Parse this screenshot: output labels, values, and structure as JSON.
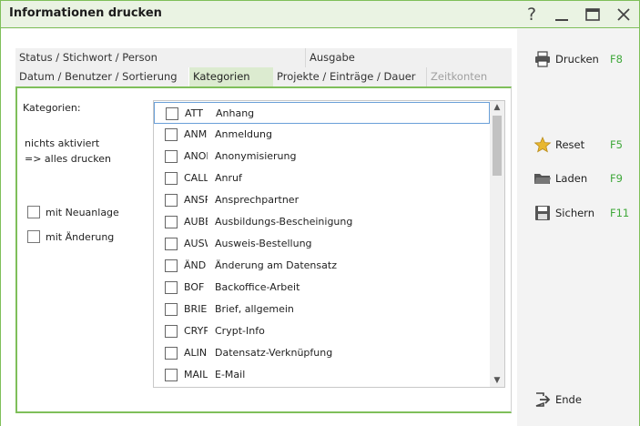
{
  "window": {
    "title": "Informationen drucken"
  },
  "titlebar": {
    "help_label": "?"
  },
  "tabs_row1": [
    {
      "label": "Status / Stichwort / Person"
    },
    {
      "label": "Ausgabe"
    }
  ],
  "tabs_row2": [
    {
      "label": "Datum / Benutzer / Sortierung"
    },
    {
      "label": "Kategorien"
    },
    {
      "label": "Projekte / Einträge / Dauer"
    },
    {
      "label": "Zeitkonten"
    }
  ],
  "panel": {
    "kategorien_label": "Kategorien:",
    "hint_line1": "nichts aktiviert",
    "hint_line2": "=> alles drucken",
    "neuanlage_label": "mit Neuanlage",
    "aenderung_label": "mit Änderung",
    "neuanlage_checked": false,
    "aenderung_checked": false
  },
  "categories": [
    {
      "code": "ATT",
      "name": "Anhang",
      "checked": false
    },
    {
      "code": "ANM",
      "name": "Anmeldung",
      "checked": false
    },
    {
      "code": "ANON",
      "name": "Anonymisierung",
      "checked": false
    },
    {
      "code": "CALL",
      "name": "Anruf",
      "checked": false
    },
    {
      "code": "ANSP",
      "name": "Ansprechpartner",
      "checked": false
    },
    {
      "code": "AUBE",
      "name": "Ausbildungs-Bescheinigung",
      "checked": false
    },
    {
      "code": "AUSW",
      "name": "Ausweis-Bestellung",
      "checked": false
    },
    {
      "code": "ÄND",
      "name": "Änderung am Datensatz",
      "checked": false
    },
    {
      "code": "BOF",
      "name": "Backoffice-Arbeit",
      "checked": false
    },
    {
      "code": "BRIEF",
      "name": "Brief, allgemein",
      "checked": false
    },
    {
      "code": "CRYPT",
      "name": "Crypt-Info",
      "checked": false
    },
    {
      "code": "ALINK",
      "name": "Datensatz-Verknüpfung",
      "checked": false
    },
    {
      "code": "MAIL",
      "name": "E-Mail",
      "checked": false
    }
  ],
  "actions": {
    "drucken": {
      "label": "Drucken",
      "key": "F8",
      "icon": "printer-icon"
    },
    "reset": {
      "label": "Reset",
      "key": "F5",
      "icon": "star-icon"
    },
    "laden": {
      "label": "Laden",
      "key": "F9",
      "icon": "folder-icon"
    },
    "sichern": {
      "label": "Sichern",
      "key": "F11",
      "icon": "floppy-disk-icon"
    },
    "ende": {
      "label": "Ende",
      "key": "",
      "icon": "exit-icon"
    }
  },
  "colors": {
    "accent": "#7fbf5a",
    "shortcut": "#3fa83a",
    "active_tab": "#dcebd0",
    "focus": "#6a9fd8"
  }
}
